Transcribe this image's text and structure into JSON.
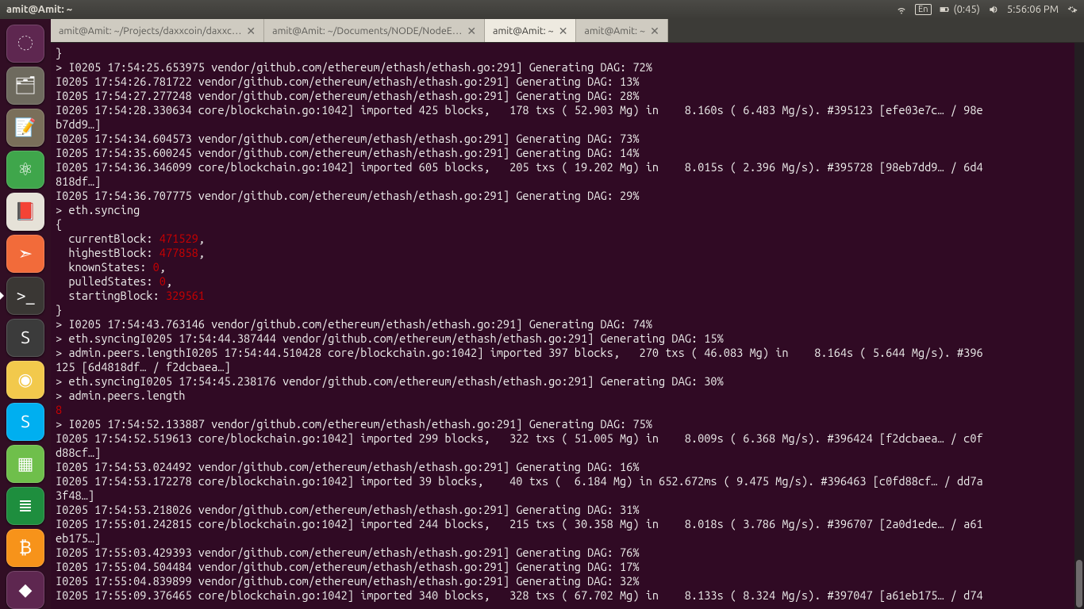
{
  "topbar": {
    "title": "amit@Amit: ~",
    "lang": "En",
    "battery": "(0:45)",
    "time": "5:56:06 PM"
  },
  "launcher": {
    "items": [
      {
        "name": "dash",
        "glyph": "◌",
        "bg": "#5e2750"
      },
      {
        "name": "files",
        "glyph": "🗂",
        "bg": "#6e6a5e"
      },
      {
        "name": "text-editor",
        "glyph": "📝",
        "bg": "#7a6f5a"
      },
      {
        "name": "atom",
        "glyph": "⚛",
        "bg": "#3fa64b"
      },
      {
        "name": "pdf-viewer",
        "glyph": "📕",
        "bg": "#e6e2d8"
      },
      {
        "name": "postman",
        "glyph": "➣",
        "bg": "#f26b3a"
      },
      {
        "name": "terminal",
        "glyph": ">_",
        "bg": "#3a3734",
        "active": true
      },
      {
        "name": "sublime",
        "glyph": "S",
        "bg": "#3b3b3b"
      },
      {
        "name": "chrome",
        "glyph": "◉",
        "bg": "#f2c94c"
      },
      {
        "name": "skype",
        "glyph": "S",
        "bg": "#00aff0"
      },
      {
        "name": "spreadsheet",
        "glyph": "▦",
        "bg": "#6fbf4b"
      },
      {
        "name": "libre",
        "glyph": "≣",
        "bg": "#1e8e3e"
      },
      {
        "name": "bitcoin",
        "glyph": "₿",
        "bg": "#f7931a"
      },
      {
        "name": "wallet",
        "glyph": "◆",
        "bg": "#5e2750"
      }
    ]
  },
  "tabs": [
    {
      "label": "amit@Amit: ~/Projects/daxxcoin/daxxc…",
      "active": false
    },
    {
      "label": "amit@Amit: ~/Documents/NODE/NodeE…",
      "active": false
    },
    {
      "label": "amit@Amit: ~",
      "active": true
    },
    {
      "label": "amit@Amit: ~",
      "active": false
    }
  ],
  "terminal": {
    "lines": [
      {
        "t": "}"
      },
      {
        "t": "> I0205 17:54:25.653975 vendor/github.com/ethereum/ethash/ethash.go:291] Generating DAG: 72%"
      },
      {
        "t": "I0205 17:54:26.781722 vendor/github.com/ethereum/ethash/ethash.go:291] Generating DAG: 13%"
      },
      {
        "t": "I0205 17:54:27.277248 vendor/github.com/ethereum/ethash/ethash.go:291] Generating DAG: 28%"
      },
      {
        "t": "I0205 17:54:28.330634 core/blockchain.go:1042] imported 425 blocks,   178 txs ( 52.903 Mg) in    8.160s ( 6.483 Mg/s). #395123 [efe03e7c… / 98e"
      },
      {
        "t": "b7dd9…]"
      },
      {
        "t": "I0205 17:54:34.604573 vendor/github.com/ethereum/ethash/ethash.go:291] Generating DAG: 73%"
      },
      {
        "t": "I0205 17:54:35.600245 vendor/github.com/ethereum/ethash/ethash.go:291] Generating DAG: 14%"
      },
      {
        "t": "I0205 17:54:36.346099 core/blockchain.go:1042] imported 605 blocks,   205 txs ( 19.202 Mg) in    8.015s ( 2.396 Mg/s). #395728 [98eb7dd9… / 6d4"
      },
      {
        "t": "818df…]"
      },
      {
        "t": "I0205 17:54:36.707775 vendor/github.com/ethereum/ethash/ethash.go:291] Generating DAG: 29%"
      },
      {
        "t": "> eth.syncing"
      },
      {
        "t": "{"
      },
      {
        "seg": [
          {
            "t": "  currentBlock: "
          },
          {
            "t": "471529",
            "c": "red"
          },
          {
            "t": ","
          }
        ]
      },
      {
        "seg": [
          {
            "t": "  highestBlock: "
          },
          {
            "t": "477858",
            "c": "red"
          },
          {
            "t": ","
          }
        ]
      },
      {
        "seg": [
          {
            "t": "  knownStates: "
          },
          {
            "t": "0",
            "c": "red"
          },
          {
            "t": ","
          }
        ]
      },
      {
        "seg": [
          {
            "t": "  pulledStates: "
          },
          {
            "t": "0",
            "c": "red"
          },
          {
            "t": ","
          }
        ]
      },
      {
        "seg": [
          {
            "t": "  startingBlock: "
          },
          {
            "t": "329561",
            "c": "red"
          }
        ]
      },
      {
        "t": "}"
      },
      {
        "t": "> I0205 17:54:43.763146 vendor/github.com/ethereum/ethash/ethash.go:291] Generating DAG: 74%"
      },
      {
        "t": "> eth.syncingI0205 17:54:44.387444 vendor/github.com/ethereum/ethash/ethash.go:291] Generating DAG: 15%"
      },
      {
        "t": "> admin.peers.lengthI0205 17:54:44.510428 core/blockchain.go:1042] imported 397 blocks,   270 txs ( 46.083 Mg) in    8.164s ( 5.644 Mg/s). #396"
      },
      {
        "t": "125 [6d4818df… / f2dcbaea…]"
      },
      {
        "t": "> eth.syncingI0205 17:54:45.238176 vendor/github.com/ethereum/ethash/ethash.go:291] Generating DAG: 30%"
      },
      {
        "t": "> admin.peers.length"
      },
      {
        "seg": [
          {
            "t": "8",
            "c": "red"
          }
        ]
      },
      {
        "t": "> I0205 17:54:52.133887 vendor/github.com/ethereum/ethash/ethash.go:291] Generating DAG: 75%"
      },
      {
        "t": "I0205 17:54:52.519613 core/blockchain.go:1042] imported 299 blocks,   322 txs ( 51.005 Mg) in    8.009s ( 6.368 Mg/s). #396424 [f2dcbaea… / c0f"
      },
      {
        "t": "d88cf…]"
      },
      {
        "t": "I0205 17:54:53.024492 vendor/github.com/ethereum/ethash/ethash.go:291] Generating DAG: 16%"
      },
      {
        "t": "I0205 17:54:53.172278 core/blockchain.go:1042] imported 39 blocks,    40 txs (  6.184 Mg) in 652.672ms ( 9.475 Mg/s). #396463 [c0fd88cf… / dd7a"
      },
      {
        "t": "3f48…]"
      },
      {
        "t": "I0205 17:54:53.218026 vendor/github.com/ethereum/ethash/ethash.go:291] Generating DAG: 31%"
      },
      {
        "t": "I0205 17:55:01.242815 core/blockchain.go:1042] imported 244 blocks,   215 txs ( 30.358 Mg) in    8.018s ( 3.786 Mg/s). #396707 [2a0d1ede… / a61"
      },
      {
        "t": "eb175…]"
      },
      {
        "t": "I0205 17:55:03.429393 vendor/github.com/ethereum/ethash/ethash.go:291] Generating DAG: 76%"
      },
      {
        "t": "I0205 17:55:04.504484 vendor/github.com/ethereum/ethash/ethash.go:291] Generating DAG: 17%"
      },
      {
        "t": "I0205 17:55:04.839899 vendor/github.com/ethereum/ethash/ethash.go:291] Generating DAG: 32%"
      },
      {
        "t": "I0205 17:55:09.376465 core/blockchain.go:1042] imported 340 blocks,   328 txs ( 67.702 Mg) in    8.133s ( 8.324 Mg/s). #397047 [a61eb175… / d74"
      }
    ]
  }
}
